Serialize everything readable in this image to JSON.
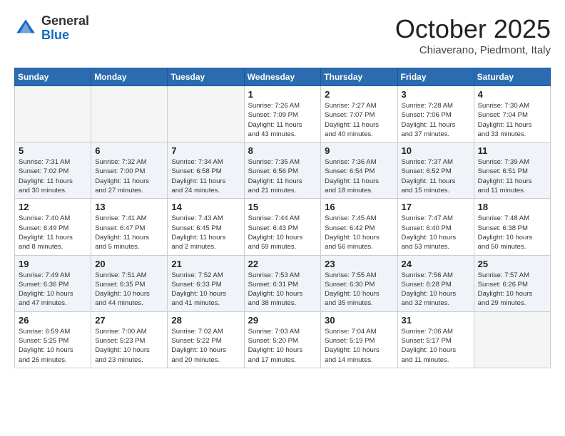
{
  "header": {
    "logo_general": "General",
    "logo_blue": "Blue",
    "month": "October 2025",
    "location": "Chiaverano, Piedmont, Italy"
  },
  "weekdays": [
    "Sunday",
    "Monday",
    "Tuesday",
    "Wednesday",
    "Thursday",
    "Friday",
    "Saturday"
  ],
  "weeks": [
    [
      {
        "day": "",
        "info": ""
      },
      {
        "day": "",
        "info": ""
      },
      {
        "day": "",
        "info": ""
      },
      {
        "day": "1",
        "info": "Sunrise: 7:26 AM\nSunset: 7:09 PM\nDaylight: 11 hours\nand 43 minutes."
      },
      {
        "day": "2",
        "info": "Sunrise: 7:27 AM\nSunset: 7:07 PM\nDaylight: 11 hours\nand 40 minutes."
      },
      {
        "day": "3",
        "info": "Sunrise: 7:28 AM\nSunset: 7:06 PM\nDaylight: 11 hours\nand 37 minutes."
      },
      {
        "day": "4",
        "info": "Sunrise: 7:30 AM\nSunset: 7:04 PM\nDaylight: 11 hours\nand 33 minutes."
      }
    ],
    [
      {
        "day": "5",
        "info": "Sunrise: 7:31 AM\nSunset: 7:02 PM\nDaylight: 11 hours\nand 30 minutes."
      },
      {
        "day": "6",
        "info": "Sunrise: 7:32 AM\nSunset: 7:00 PM\nDaylight: 11 hours\nand 27 minutes."
      },
      {
        "day": "7",
        "info": "Sunrise: 7:34 AM\nSunset: 6:58 PM\nDaylight: 11 hours\nand 24 minutes."
      },
      {
        "day": "8",
        "info": "Sunrise: 7:35 AM\nSunset: 6:56 PM\nDaylight: 11 hours\nand 21 minutes."
      },
      {
        "day": "9",
        "info": "Sunrise: 7:36 AM\nSunset: 6:54 PM\nDaylight: 11 hours\nand 18 minutes."
      },
      {
        "day": "10",
        "info": "Sunrise: 7:37 AM\nSunset: 6:52 PM\nDaylight: 11 hours\nand 15 minutes."
      },
      {
        "day": "11",
        "info": "Sunrise: 7:39 AM\nSunset: 6:51 PM\nDaylight: 11 hours\nand 11 minutes."
      }
    ],
    [
      {
        "day": "12",
        "info": "Sunrise: 7:40 AM\nSunset: 6:49 PM\nDaylight: 11 hours\nand 8 minutes."
      },
      {
        "day": "13",
        "info": "Sunrise: 7:41 AM\nSunset: 6:47 PM\nDaylight: 11 hours\nand 5 minutes."
      },
      {
        "day": "14",
        "info": "Sunrise: 7:43 AM\nSunset: 6:45 PM\nDaylight: 11 hours\nand 2 minutes."
      },
      {
        "day": "15",
        "info": "Sunrise: 7:44 AM\nSunset: 6:43 PM\nDaylight: 10 hours\nand 59 minutes."
      },
      {
        "day": "16",
        "info": "Sunrise: 7:45 AM\nSunset: 6:42 PM\nDaylight: 10 hours\nand 56 minutes."
      },
      {
        "day": "17",
        "info": "Sunrise: 7:47 AM\nSunset: 6:40 PM\nDaylight: 10 hours\nand 53 minutes."
      },
      {
        "day": "18",
        "info": "Sunrise: 7:48 AM\nSunset: 6:38 PM\nDaylight: 10 hours\nand 50 minutes."
      }
    ],
    [
      {
        "day": "19",
        "info": "Sunrise: 7:49 AM\nSunset: 6:36 PM\nDaylight: 10 hours\nand 47 minutes."
      },
      {
        "day": "20",
        "info": "Sunrise: 7:51 AM\nSunset: 6:35 PM\nDaylight: 10 hours\nand 44 minutes."
      },
      {
        "day": "21",
        "info": "Sunrise: 7:52 AM\nSunset: 6:33 PM\nDaylight: 10 hours\nand 41 minutes."
      },
      {
        "day": "22",
        "info": "Sunrise: 7:53 AM\nSunset: 6:31 PM\nDaylight: 10 hours\nand 38 minutes."
      },
      {
        "day": "23",
        "info": "Sunrise: 7:55 AM\nSunset: 6:30 PM\nDaylight: 10 hours\nand 35 minutes."
      },
      {
        "day": "24",
        "info": "Sunrise: 7:56 AM\nSunset: 6:28 PM\nDaylight: 10 hours\nand 32 minutes."
      },
      {
        "day": "25",
        "info": "Sunrise: 7:57 AM\nSunset: 6:26 PM\nDaylight: 10 hours\nand 29 minutes."
      }
    ],
    [
      {
        "day": "26",
        "info": "Sunrise: 6:59 AM\nSunset: 5:25 PM\nDaylight: 10 hours\nand 26 minutes."
      },
      {
        "day": "27",
        "info": "Sunrise: 7:00 AM\nSunset: 5:23 PM\nDaylight: 10 hours\nand 23 minutes."
      },
      {
        "day": "28",
        "info": "Sunrise: 7:02 AM\nSunset: 5:22 PM\nDaylight: 10 hours\nand 20 minutes."
      },
      {
        "day": "29",
        "info": "Sunrise: 7:03 AM\nSunset: 5:20 PM\nDaylight: 10 hours\nand 17 minutes."
      },
      {
        "day": "30",
        "info": "Sunrise: 7:04 AM\nSunset: 5:19 PM\nDaylight: 10 hours\nand 14 minutes."
      },
      {
        "day": "31",
        "info": "Sunrise: 7:06 AM\nSunset: 5:17 PM\nDaylight: 10 hours\nand 11 minutes."
      },
      {
        "day": "",
        "info": ""
      }
    ]
  ]
}
